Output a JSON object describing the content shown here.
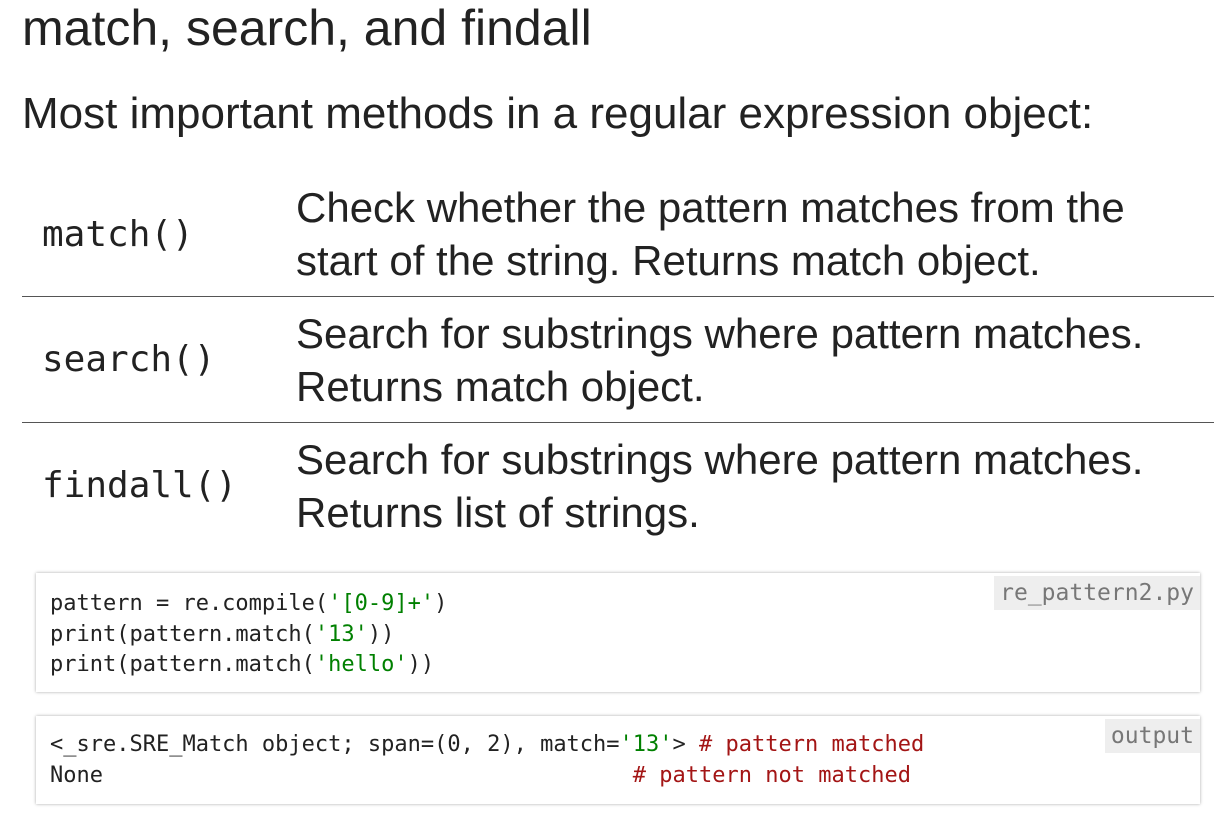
{
  "heading": {
    "title": "match, search, and findall",
    "subtitle": "Most important methods in a regular expression object:"
  },
  "methods": [
    {
      "name": "match()",
      "desc_line1": "Check whether the pattern matches from the",
      "desc_line2": "start of the string. Returns match object."
    },
    {
      "name": "search()",
      "desc_line1": "Search for substrings where pattern matches.",
      "desc_line2": "Returns match object."
    },
    {
      "name": "findall()",
      "desc_line1": "Search for substrings where pattern matches.",
      "desc_line2": "Returns list of strings."
    }
  ],
  "source_code": {
    "label": "re_pattern2.py",
    "line1": {
      "a": "pattern = re.compile(",
      "s": "'[0-9]+'",
      "b": ")"
    },
    "line2": {
      "a": "print(pattern.match(",
      "s": "'13'",
      "b": "))"
    },
    "line3": {
      "a": "print(pattern.match(",
      "s": "'hello'",
      "b": "))"
    }
  },
  "output": {
    "label": "output",
    "line1": {
      "a": "<_sre.SRE_Match object; span=(0, 2), match=",
      "s": "'13'",
      "b": "> ",
      "c": "# pattern matched"
    },
    "line2": {
      "a": "None                                        ",
      "c": "# pattern not matched"
    }
  },
  "colors": {
    "text": "#222222",
    "string": "#008000",
    "comment": "#a31515",
    "label_bg": "#eeeeee",
    "label_text": "#777777"
  }
}
